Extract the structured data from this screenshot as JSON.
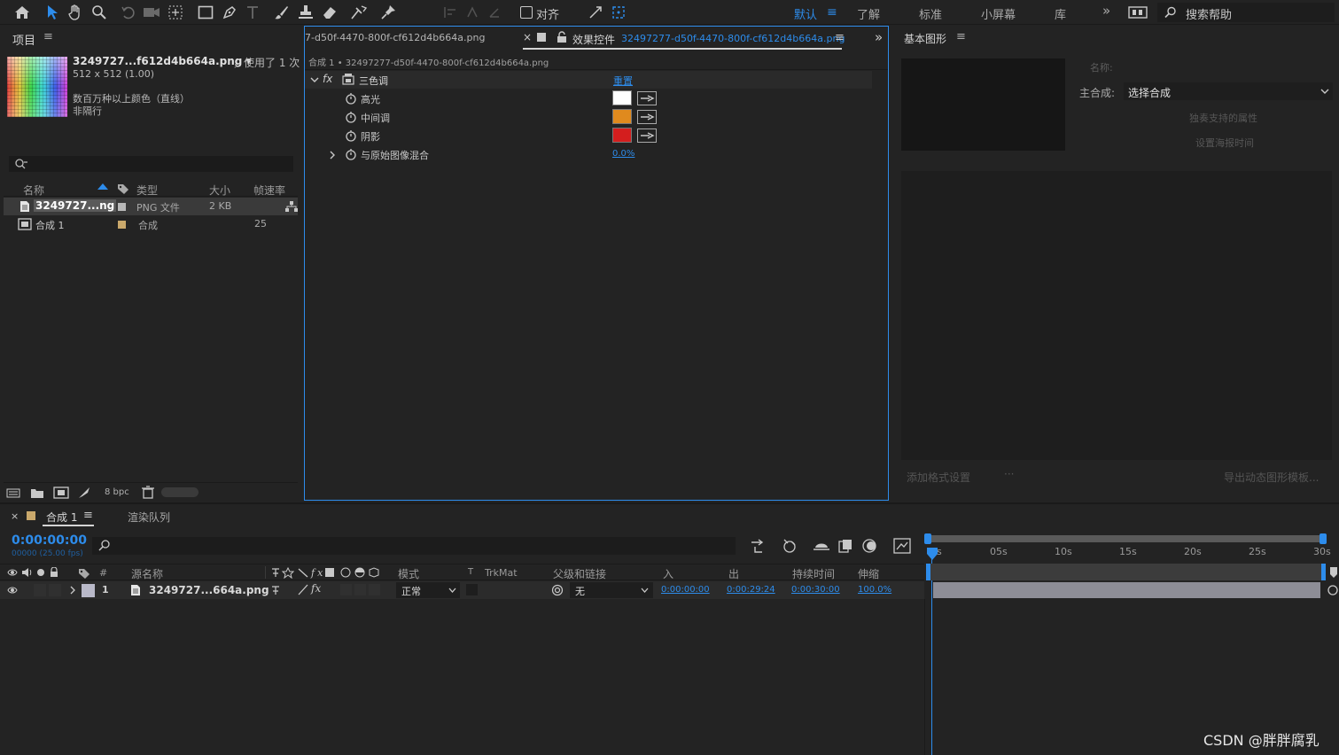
{
  "toolbar": {
    "align_label": "对齐",
    "workspaces": [
      "默认",
      "了解",
      "标准",
      "小屏幕",
      "库"
    ],
    "more_label": "»",
    "search_placeholder": "搜索帮助"
  },
  "project": {
    "title": "项目",
    "file_name": "3249727...f612d4b664a.png ▾",
    "used_text": "，使用了 1 次",
    "dims": "512 x 512 (1.00)",
    "colors": "数百万种以上颜色（直线）",
    "interlace": "非隔行",
    "columns": {
      "name": "名称",
      "type": "类型",
      "size": "大小",
      "fps": "帧速率"
    },
    "items": [
      {
        "name": "3249727...ng",
        "type": "PNG 文件",
        "size": "2 KB",
        "fps": "",
        "label_color": "#b9b9b9"
      },
      {
        "name": "合成 1",
        "type": "合成",
        "size": "",
        "fps": "25",
        "label_color": "#c9a86b"
      }
    ],
    "bpc": "8 bpc"
  },
  "effects": {
    "tab_left": "7-d50f-4470-800f-cf612d4b664a.png",
    "tab_right_prefix": "效果控件",
    "tab_right_file": "32497277-d50f-4470-800f-cf612d4b664a.png",
    "breadcrumb": "合成 1 • 32497277-d50f-4470-800f-cf612d4b664a.png",
    "fx_label": "fx",
    "effect_name": "三色调",
    "reset_label": "重置",
    "props": [
      {
        "name": "高光",
        "color": "#ffffff"
      },
      {
        "name": "中间调",
        "color": "#e08a1e"
      },
      {
        "name": "阴影",
        "color": "#d41e1e"
      }
    ],
    "blend_name": "与原始图像混合",
    "blend_value": "0.0%"
  },
  "essential": {
    "title": "基本图形",
    "name_label": "名称:",
    "master_label": "主合成:",
    "master_value": "选择合成",
    "solo_label": "独奏支持的属性",
    "poster_label": "设置海报时间",
    "add_format": "添加格式设置",
    "export_label": "导出动态图形模板..."
  },
  "timeline": {
    "tab_comp": "合成 1",
    "tab_render": "渲染队列",
    "timecode": "0:00:00:00",
    "frames": "00000 (25.00 fps)",
    "ruler": [
      "0s",
      "05s",
      "10s",
      "15s",
      "20s",
      "25s",
      "30s"
    ],
    "columns": {
      "num": "#",
      "source": "源名称",
      "mode": "模式",
      "t": "T",
      "trkmat": "TrkMat",
      "parent": "父级和链接",
      "in": "入",
      "out": "出",
      "duration": "持续时间",
      "stretch": "伸缩"
    },
    "layer": {
      "num": "1",
      "name": "3249727...664a.png",
      "mode": "正常",
      "parent": "无",
      "in": "0:00:00:00",
      "out": "0:00:29:24",
      "duration": "0:00:30:00",
      "stretch": "100.0%"
    }
  },
  "watermark": "CSDN @胖胖腐乳"
}
